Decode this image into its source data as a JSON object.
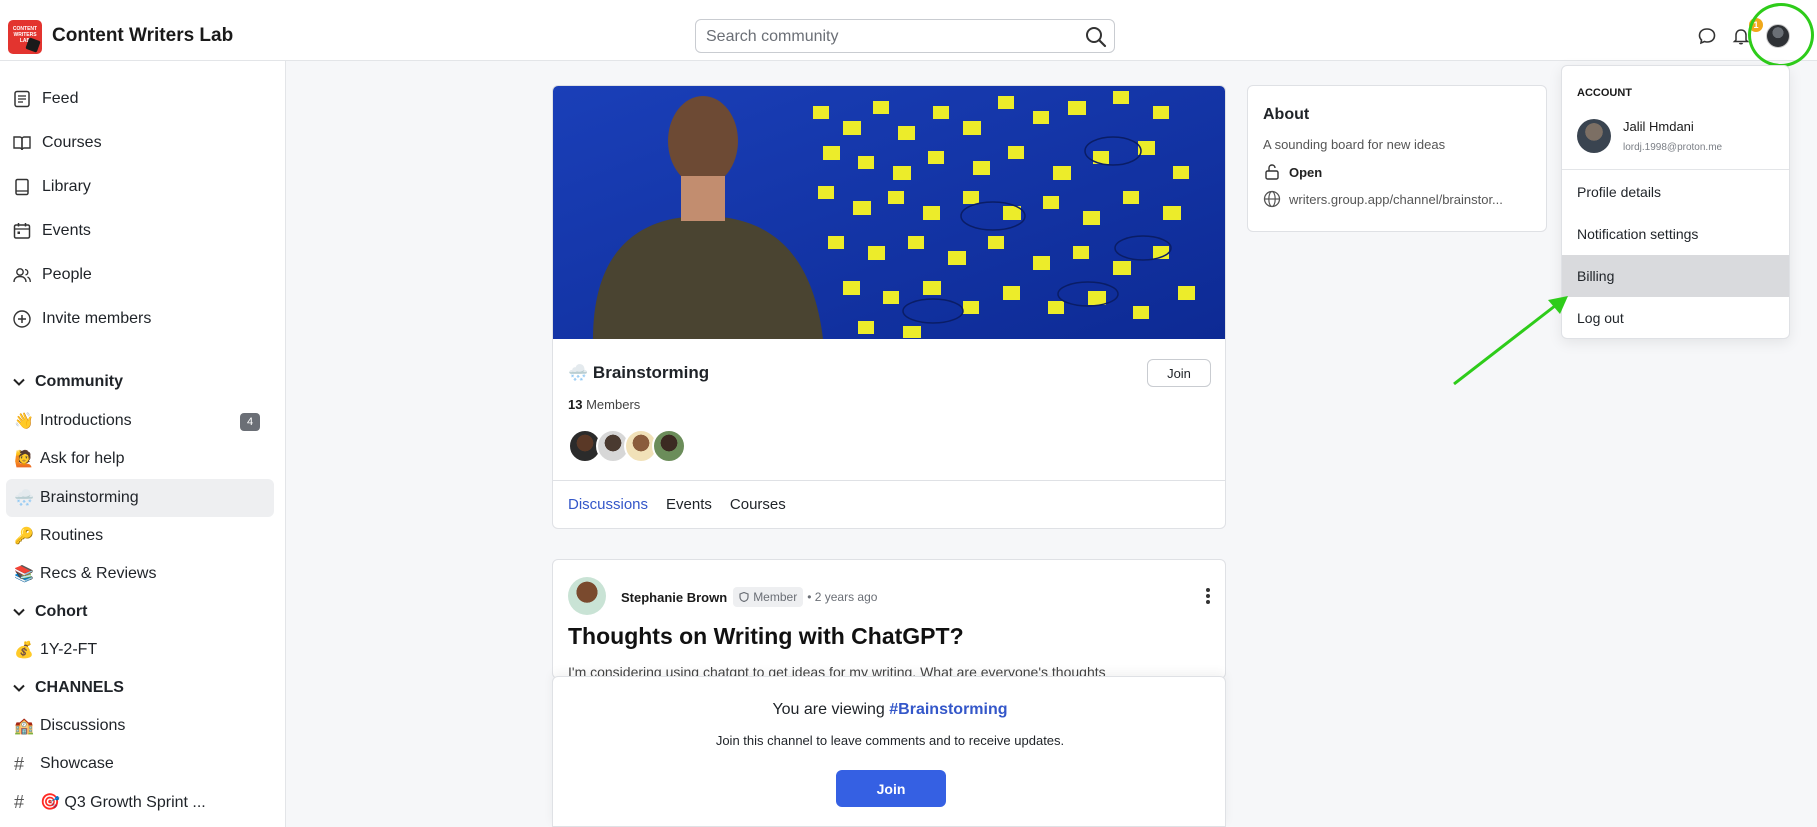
{
  "app": {
    "logo_text": "CONTENT WRITERS LAB",
    "title": "Content Writers Lab"
  },
  "search": {
    "placeholder": "Search community"
  },
  "header": {
    "notification_count": "1",
    "icons": [
      "chat-icon",
      "bell-icon",
      "avatar"
    ]
  },
  "sidebar": {
    "nav": [
      {
        "label": "Feed",
        "icon": "feed-icon"
      },
      {
        "label": "Courses",
        "icon": "book-open-icon"
      },
      {
        "label": "Library",
        "icon": "book-icon"
      },
      {
        "label": "Events",
        "icon": "calendar-icon"
      },
      {
        "label": "People",
        "icon": "people-icon"
      },
      {
        "label": "Invite members",
        "icon": "plus-circle-icon"
      }
    ],
    "sections": [
      {
        "title": "Community",
        "items": [
          {
            "emoji": "👋",
            "label": "Introductions",
            "badge": "4"
          },
          {
            "emoji": "🙋",
            "label": "Ask for help"
          },
          {
            "emoji": "🌨️",
            "label": "Brainstorming",
            "active": true
          },
          {
            "emoji": "🔑",
            "label": "Routines"
          },
          {
            "emoji": "📚",
            "label": "Recs & Reviews"
          }
        ]
      },
      {
        "title": "Cohort",
        "items": [
          {
            "emoji": "💰",
            "label": "1Y-2-FT"
          }
        ]
      },
      {
        "title": "CHANNELS",
        "items": [
          {
            "emoji": "🏫",
            "label": "Discussions"
          },
          {
            "emoji": "#",
            "label": "Showcase"
          },
          {
            "emoji": "#",
            "label": "🎯 Q3 Growth Sprint ..."
          }
        ]
      }
    ]
  },
  "channel": {
    "emoji": "🌨️",
    "name": "Brainstorming",
    "join_label": "Join",
    "member_count": "13",
    "members_label": "Members",
    "tabs": [
      "Discussions",
      "Events",
      "Courses"
    ],
    "active_tab": "Discussions"
  },
  "post": {
    "author": "Stephanie Brown",
    "role": "Member",
    "time": "• 2 years ago",
    "title": "Thoughts on Writing with ChatGPT?",
    "excerpt": "I'm considering using chatgpt to get ideas for my writing. What are everyone's thoughts"
  },
  "join_prompt": {
    "prefix": "You are viewing",
    "channel": "#Brainstorming",
    "hint": "Join this channel to leave comments and to receive updates.",
    "button": "Join"
  },
  "about": {
    "title": "About",
    "description": "A sounding board for new ideas",
    "visibility": "Open",
    "url": "writers.group.app/channel/brainstor..."
  },
  "account_menu": {
    "header": "ACCOUNT",
    "name": "Jalil Hmdani",
    "email": "lordj.1998@proton.me",
    "items": [
      "Profile details",
      "Notification settings",
      "Billing",
      "Log out"
    ],
    "highlighted": "Billing"
  },
  "colors": {
    "accent": "#3457c9",
    "join_button": "#3560e3",
    "logo": "#e3342f",
    "annotation": "#2ecc1a",
    "badge": "#f0a81a"
  }
}
